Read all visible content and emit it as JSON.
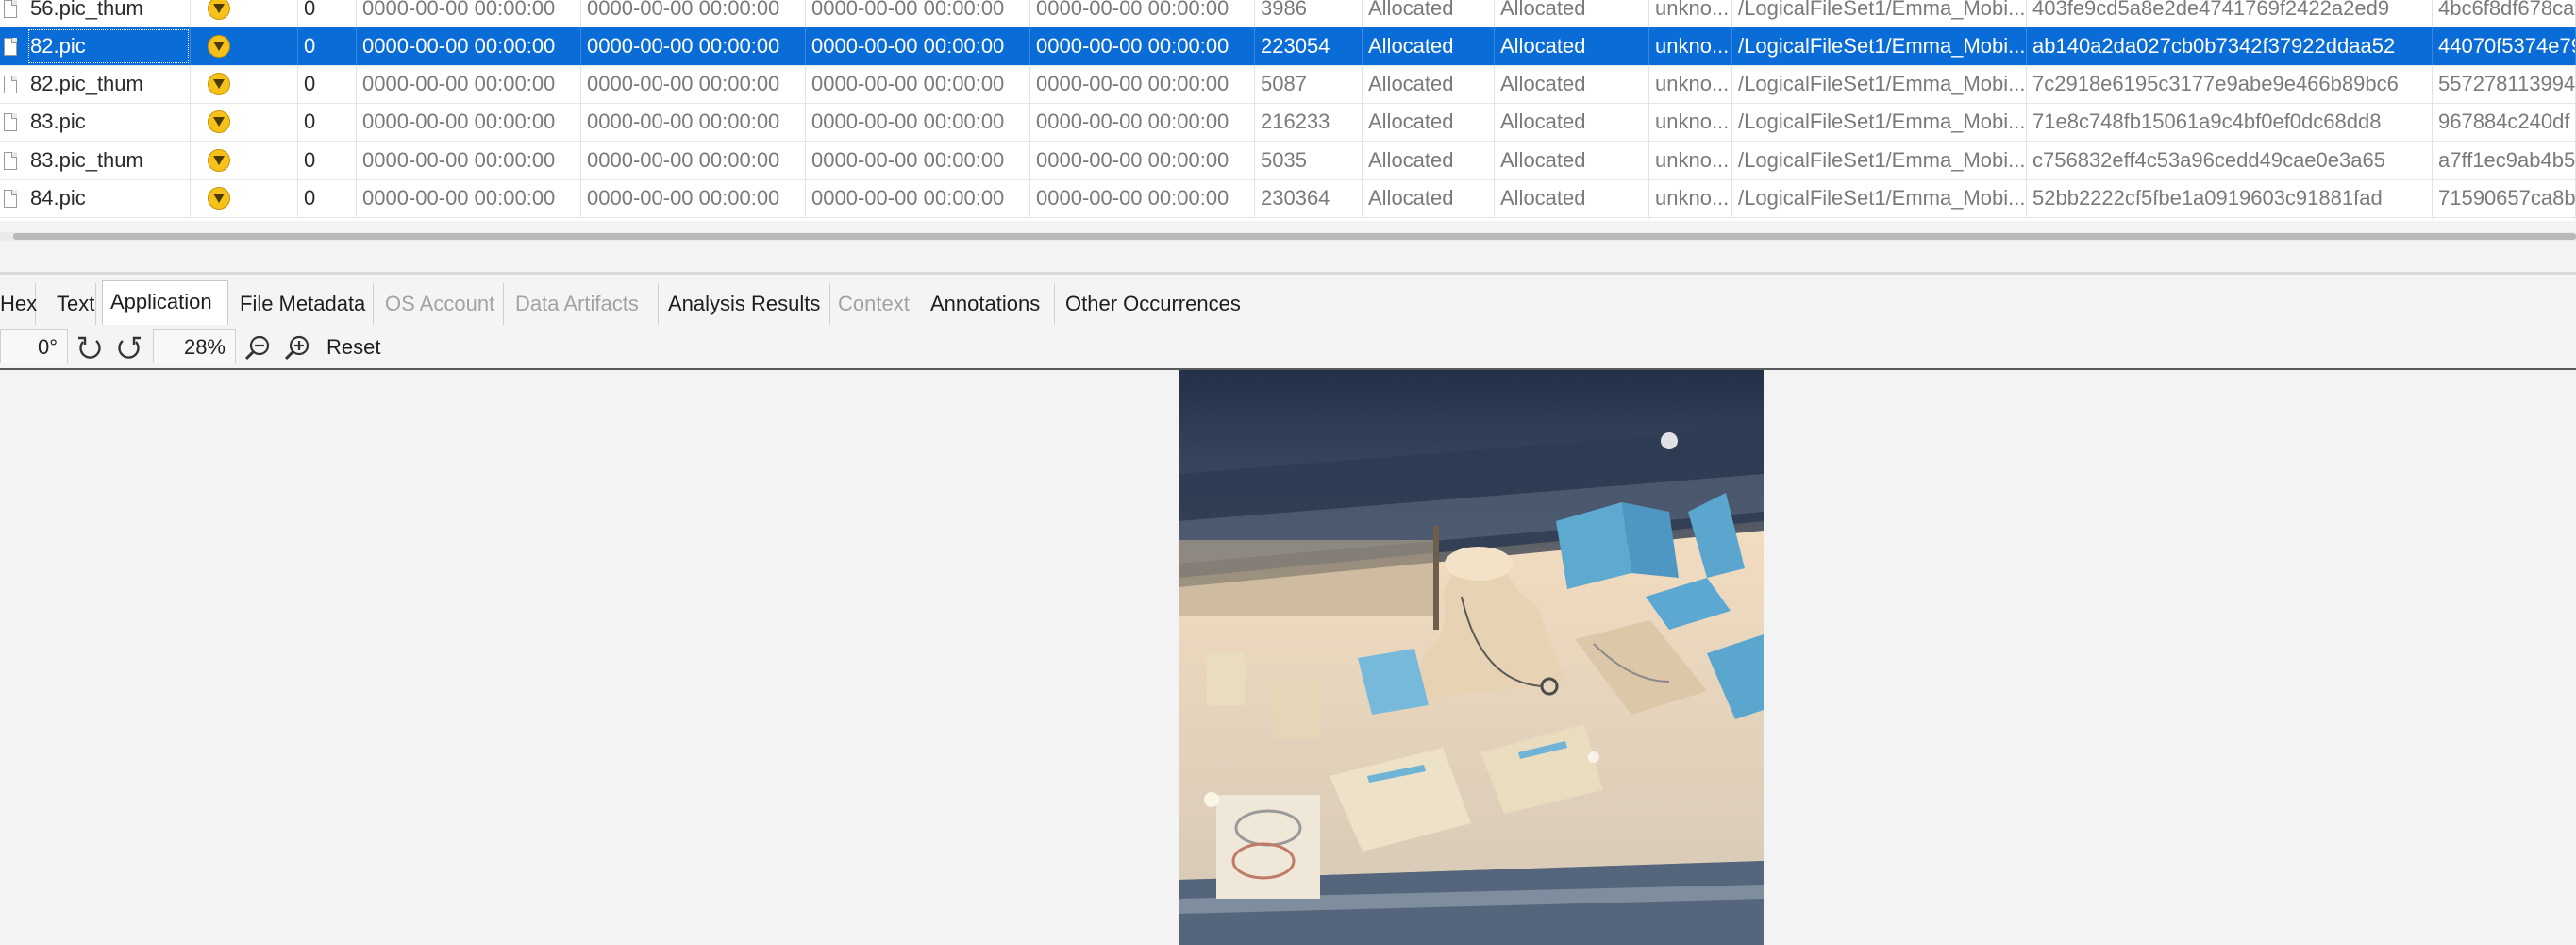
{
  "table": {
    "rows": [
      {
        "name": "56.pic_thum",
        "score": "0",
        "t1": "0000-00-00 00:00:00",
        "t2": "0000-00-00 00:00:00",
        "t3": "0000-00-00 00:00:00",
        "t4": "0000-00-00 00:00:00",
        "size": "3986",
        "flags_dir": "Allocated",
        "flags_meta": "Allocated",
        "known": "unkno...",
        "path": "/LogicalFileSet1/Emma_Mobi...",
        "md5": "403fe9cd5a8e2de4741769f2422a2ed9",
        "sha": "4bc6f8df678ca",
        "selected": false
      },
      {
        "name": "82.pic",
        "score": "0",
        "t1": "0000-00-00 00:00:00",
        "t2": "0000-00-00 00:00:00",
        "t3": "0000-00-00 00:00:00",
        "t4": "0000-00-00 00:00:00",
        "size": "223054",
        "flags_dir": "Allocated",
        "flags_meta": "Allocated",
        "known": "unkno...",
        "path": "/LogicalFileSet1/Emma_Mobi...",
        "md5": "ab140a2da027cb0b7342f37922ddaa52",
        "sha": "44070f5374e79",
        "selected": true
      },
      {
        "name": "82.pic_thum",
        "score": "0",
        "t1": "0000-00-00 00:00:00",
        "t2": "0000-00-00 00:00:00",
        "t3": "0000-00-00 00:00:00",
        "t4": "0000-00-00 00:00:00",
        "size": "5087",
        "flags_dir": "Allocated",
        "flags_meta": "Allocated",
        "known": "unkno...",
        "path": "/LogicalFileSet1/Emma_Mobi...",
        "md5": "7c2918e6195c3177e9abe9e466b89bc6",
        "sha": "557278113994",
        "selected": false
      },
      {
        "name": "83.pic",
        "score": "0",
        "t1": "0000-00-00 00:00:00",
        "t2": "0000-00-00 00:00:00",
        "t3": "0000-00-00 00:00:00",
        "t4": "0000-00-00 00:00:00",
        "size": "216233",
        "flags_dir": "Allocated",
        "flags_meta": "Allocated",
        "known": "unkno...",
        "path": "/LogicalFileSet1/Emma_Mobi...",
        "md5": "71e8c748fb15061a9c4bf0ef0dc68dd8",
        "sha": "967884c240df",
        "selected": false
      },
      {
        "name": "83.pic_thum",
        "score": "0",
        "t1": "0000-00-00 00:00:00",
        "t2": "0000-00-00 00:00:00",
        "t3": "0000-00-00 00:00:00",
        "t4": "0000-00-00 00:00:00",
        "size": "5035",
        "flags_dir": "Allocated",
        "flags_meta": "Allocated",
        "known": "unkno...",
        "path": "/LogicalFileSet1/Emma_Mobi...",
        "md5": "c756832eff4c53a96cedd49cae0e3a65",
        "sha": "a7ff1ec9ab4b5",
        "selected": false
      },
      {
        "name": "84.pic",
        "score": "0",
        "t1": "0000-00-00 00:00:00",
        "t2": "0000-00-00 00:00:00",
        "t3": "0000-00-00 00:00:00",
        "t4": "0000-00-00 00:00:00",
        "size": "230364",
        "flags_dir": "Allocated",
        "flags_meta": "Allocated",
        "known": "unkno...",
        "path": "/LogicalFileSet1/Emma_Mobi...",
        "md5": "52bb2222cf5fbe1a0919603c91881fad",
        "sha": "71590657ca8b",
        "selected": false
      }
    ]
  },
  "tabs": [
    {
      "label": "Hex",
      "state": "normal"
    },
    {
      "label": "Text",
      "state": "normal"
    },
    {
      "label": "Application",
      "state": "active"
    },
    {
      "label": "File Metadata",
      "state": "normal"
    },
    {
      "label": "OS Account",
      "state": "disabled"
    },
    {
      "label": "Data Artifacts",
      "state": "disabled"
    },
    {
      "label": "Analysis Results",
      "state": "normal"
    },
    {
      "label": "Context",
      "state": "disabled"
    },
    {
      "label": "Annotations",
      "state": "normal"
    },
    {
      "label": "Other Occurrences",
      "state": "normal"
    }
  ],
  "toolbar": {
    "rotation": "0°",
    "zoom": "28%",
    "reset_label": "Reset",
    "icons": [
      "rotate-left-icon",
      "rotate-right-icon",
      "zoom-out-icon",
      "zoom-in-icon"
    ]
  },
  "colors": {
    "selection": "#0a6cd6",
    "tag_icon": "#f6c21a"
  },
  "viewer": {
    "image_subject": "jewelry display case photo"
  }
}
